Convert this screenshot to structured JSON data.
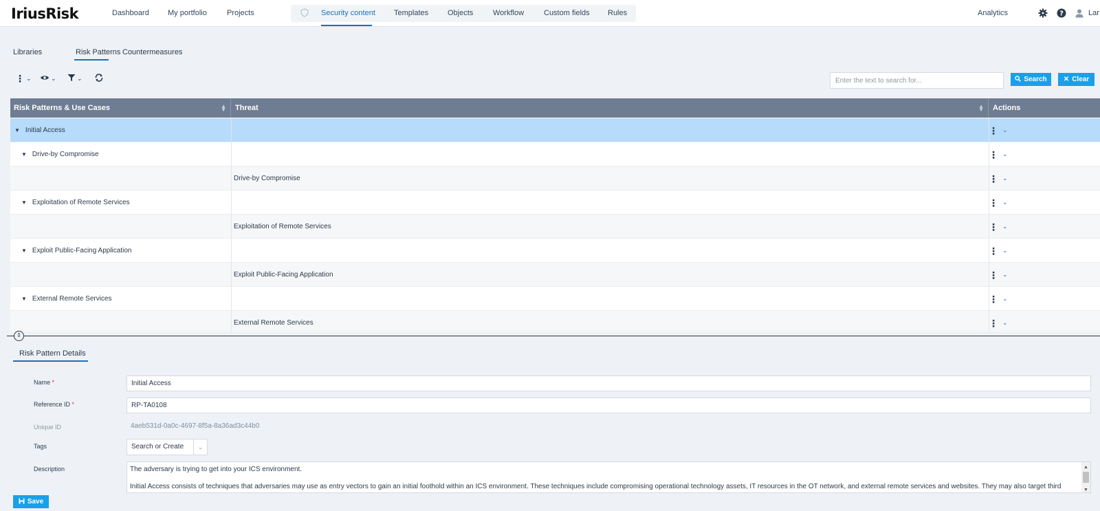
{
  "brand": {
    "logo": "IriusRisk"
  },
  "nav": {
    "items_left": [
      "Dashboard",
      "My portfolio",
      "Projects"
    ],
    "items_group": [
      "Security content",
      "Templates",
      "Objects",
      "Workflow",
      "Custom fields",
      "Rules"
    ],
    "active": "Security content",
    "analytics": "Analytics",
    "user": "Lar"
  },
  "subtabs": [
    "Libraries",
    "Risk Patterns",
    "Countermeasures"
  ],
  "active_subtab": "Risk Patterns",
  "search": {
    "placeholder": "Enter the text to search for...",
    "search_label": "Search",
    "clear_label": "Clear"
  },
  "grid": {
    "columns": [
      "Risk Patterns & Use Cases",
      "Threat",
      "Actions"
    ],
    "rows": [
      {
        "level": 0,
        "pattern": "Initial Access",
        "threat": "",
        "expanded": true,
        "selected": true
      },
      {
        "level": 1,
        "pattern": "Drive-by Compromise",
        "threat": "",
        "expanded": true
      },
      {
        "level": 2,
        "pattern": "",
        "threat": "Drive-by Compromise"
      },
      {
        "level": 1,
        "pattern": "Exploitation of Remote Services",
        "threat": "",
        "expanded": true
      },
      {
        "level": 2,
        "pattern": "",
        "threat": "Exploitation of Remote Services"
      },
      {
        "level": 1,
        "pattern": "Exploit Public-Facing Application",
        "threat": "",
        "expanded": true
      },
      {
        "level": 2,
        "pattern": "",
        "threat": "Exploit Public-Facing Application"
      },
      {
        "level": 1,
        "pattern": "External Remote Services",
        "threat": "",
        "expanded": true
      },
      {
        "level": 2,
        "pattern": "",
        "threat": "External Remote Services"
      }
    ]
  },
  "details": {
    "tab": "Risk Pattern Details",
    "name_label": "Name",
    "name_value": "Initial Access",
    "ref_label": "Reference ID",
    "ref_value": "RP-TA0108",
    "uid_label": "Unique ID",
    "uid_value": "4aeb531d-0a0c-4697-8f5a-8a36ad3c44b0",
    "tags_label": "Tags",
    "tags_placeholder": "Search or Create",
    "desc_label": "Description",
    "desc_line1": "The adversary is trying to get into your ICS environment.",
    "desc_line2": "Initial Access consists of techniques that adversaries may use as entry vectors to gain an initial foothold within an ICS environment. These techniques include compromising operational technology assets, IT resources in the OT network, and external remote services and websites. They may also target third",
    "save_label": "Save"
  },
  "colors": {
    "accent": "#1d6fb8",
    "button": "#1aa0e8",
    "header": "#6f7d93",
    "selected_row": "#b6dbfb"
  }
}
